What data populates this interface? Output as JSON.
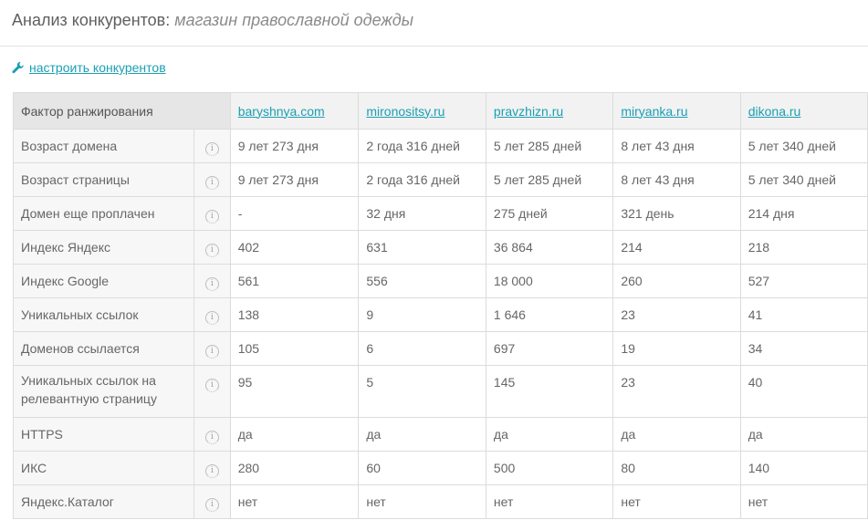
{
  "header": {
    "title": "Анализ конкурентов:",
    "subtitle": "магазин православной одежды"
  },
  "settings": {
    "link_label": "настроить конкурентов",
    "icon": "wrench-icon"
  },
  "table": {
    "factor_header": "Фактор ранжирования",
    "competitors": [
      "baryshnya.com",
      "mironositsy.ru",
      "pravzhizn.ru",
      "miryanka.ru",
      "dikona.ru"
    ],
    "rows": [
      {
        "label": "Возраст домена",
        "values": [
          "9 лет 273 дня",
          "2 года 316 дней",
          "5 лет 285 дней",
          "8 лет 43 дня",
          "5 лет 340 дней"
        ]
      },
      {
        "label": "Возраст страницы",
        "values": [
          "9 лет 273 дня",
          "2 года 316 дней",
          "5 лет 285 дней",
          "8 лет 43 дня",
          "5 лет 340 дней"
        ]
      },
      {
        "label": "Домен еще проплачен",
        "values": [
          "-",
          "32 дня",
          "275 дней",
          "321 день",
          "214 дня"
        ]
      },
      {
        "label": "Индекс Яндекс",
        "values": [
          "402",
          "631",
          "36 864",
          "214",
          "218"
        ]
      },
      {
        "label": "Индекс Google",
        "values": [
          "561",
          "556",
          "18 000",
          "260",
          "527"
        ]
      },
      {
        "label": "Уникальных ссылок",
        "values": [
          "138",
          "9",
          "1 646",
          "23",
          "41"
        ]
      },
      {
        "label": "Доменов ссылается",
        "values": [
          "105",
          "6",
          "697",
          "19",
          "34"
        ]
      },
      {
        "label": "Уникальных ссылок на релевантную страницу",
        "values": [
          "95",
          "5",
          "145",
          "23",
          "40"
        ]
      },
      {
        "label": "HTTPS",
        "values": [
          "да",
          "да",
          "да",
          "да",
          "да"
        ]
      },
      {
        "label": "ИКС",
        "values": [
          "280",
          "60",
          "500",
          "80",
          "140"
        ]
      },
      {
        "label": "Яндекс.Каталог",
        "values": [
          "нет",
          "нет",
          "нет",
          "нет",
          "нет"
        ]
      }
    ],
    "info_icon_glyph": "i"
  },
  "colors": {
    "accent": "#1a9fb3",
    "header_bg": "#f2f2f2",
    "label_bg": "#f7f7f7",
    "border": "#dcdcdc"
  }
}
